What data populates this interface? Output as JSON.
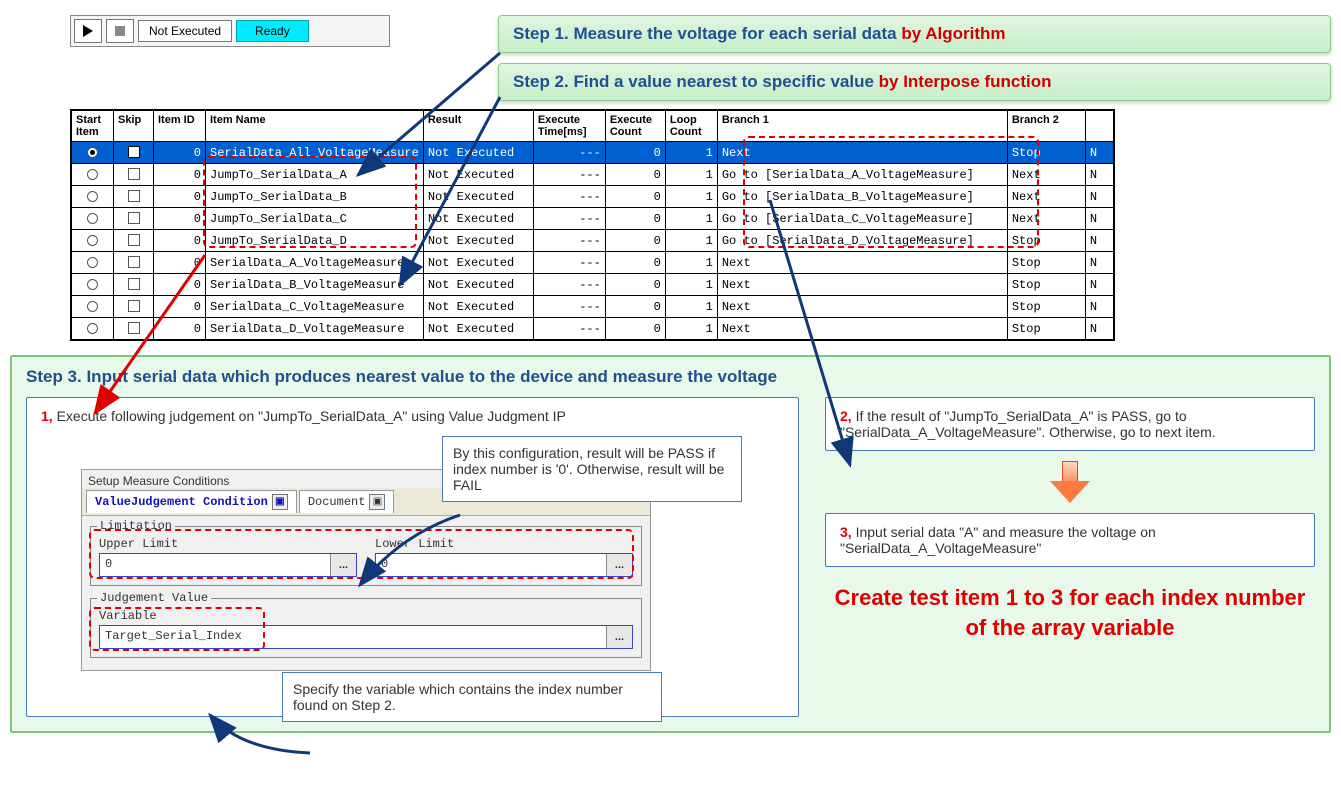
{
  "steps": {
    "s1_a": "Step 1. Measure the voltage for each serial data ",
    "s1_b": "by Algorithm",
    "s2_a": "Step 2. Find a value nearest to specific value ",
    "s2_b": "by Interpose function",
    "s3_title": "Step 3. Input serial data which produces nearest value to the device and measure the voltage"
  },
  "toolbar": {
    "not_executed": "Not Executed",
    "ready": "Ready"
  },
  "grid": {
    "headers": {
      "start": "Start\nItem",
      "skip": "Skip",
      "item_id": "Item ID",
      "item_name": "Item Name",
      "result": "Result",
      "exec_time": "Execute\nTime[ms]",
      "exec_count": "Execute\nCount",
      "loop_count": "Loop\nCount",
      "branch1": "Branch 1",
      "branch2": "Branch 2"
    },
    "rows": [
      {
        "sel": true,
        "start": true,
        "skip": true,
        "id": "0",
        "name": "SerialData_All_VoltageMeasure",
        "result": "Not Executed",
        "time": "---",
        "ecount": "0",
        "lcount": "1",
        "b1": "Next",
        "b2": "Stop",
        "b3": "N"
      },
      {
        "sel": false,
        "start": false,
        "skip": false,
        "id": "0",
        "name": "JumpTo_SerialData_A",
        "result": "Not Executed",
        "time": "---",
        "ecount": "0",
        "lcount": "1",
        "b1": "Go to [SerialData_A_VoltageMeasure]",
        "b2": "Next",
        "b3": "N"
      },
      {
        "sel": false,
        "start": false,
        "skip": false,
        "id": "0",
        "name": "JumpTo_SerialData_B",
        "result": "Not Executed",
        "time": "---",
        "ecount": "0",
        "lcount": "1",
        "b1": "Go to [SerialData_B_VoltageMeasure]",
        "b2": "Next",
        "b3": "N"
      },
      {
        "sel": false,
        "start": false,
        "skip": false,
        "id": "0",
        "name": "JumpTo_SerialData_C",
        "result": "Not Executed",
        "time": "---",
        "ecount": "0",
        "lcount": "1",
        "b1": "Go to [SerialData_C_VoltageMeasure]",
        "b2": "Next",
        "b3": "N"
      },
      {
        "sel": false,
        "start": false,
        "skip": false,
        "id": "0",
        "name": "JumpTo_SerialData_D",
        "result": "Not Executed",
        "time": "---",
        "ecount": "0",
        "lcount": "1",
        "b1": "Go to [SerialData_D_VoltageMeasure]",
        "b2": "Stop",
        "b3": "N"
      },
      {
        "sel": false,
        "start": false,
        "skip": false,
        "id": "0",
        "name": "SerialData_A_VoltageMeasure",
        "result": "Not Executed",
        "time": "---",
        "ecount": "0",
        "lcount": "1",
        "b1": "Next",
        "b2": "Stop",
        "b3": "N"
      },
      {
        "sel": false,
        "start": false,
        "skip": false,
        "id": "0",
        "name": "SerialData_B_VoltageMeasure",
        "result": "Not Executed",
        "time": "---",
        "ecount": "0",
        "lcount": "1",
        "b1": "Next",
        "b2": "Stop",
        "b3": "N"
      },
      {
        "sel": false,
        "start": false,
        "skip": false,
        "id": "0",
        "name": "SerialData_C_VoltageMeasure",
        "result": "Not Executed",
        "time": "---",
        "ecount": "0",
        "lcount": "1",
        "b1": "Next",
        "b2": "Stop",
        "b3": "N"
      },
      {
        "sel": false,
        "start": false,
        "skip": false,
        "id": "0",
        "name": "SerialData_D_VoltageMeasure",
        "result": "Not Executed",
        "time": "---",
        "ecount": "0",
        "lcount": "1",
        "b1": "Next",
        "b2": "Stop",
        "b3": "N"
      }
    ]
  },
  "notes": {
    "n1_num": "1,",
    "n1_txt": " Execute following judgement on \"JumpTo_SerialData_A\" using Value Judgment IP",
    "config": "By this configuration, result will be PASS if index number is '0'. Otherwise, result will be FAIL",
    "spec": "Specify the variable which contains the index number found on Step 2.",
    "n2_num": "2,",
    "n2_txt": " If the result of \"JumpTo_SerialData_A\" is PASS, go to \"SerialData_A_VoltageMeasure\". Otherwise, go to next item.",
    "n3_num": "3,",
    "n3_txt": " Input serial data \"A\" and measure the voltage on \"SerialData_A_VoltageMeasure\"",
    "big": "Create test item 1 to 3 for each index number of the array variable"
  },
  "setup": {
    "title": "Setup Measure Conditions",
    "tab1": "ValueJudgement Condition",
    "tab2": "Document",
    "limitation": "Limitation",
    "upper": "Upper Limit",
    "upper_val": "0",
    "lower": "Lower Limit",
    "lower_val": "0",
    "jv": "Judgement Value",
    "variable": "Variable",
    "var_val": "Target_Serial_Index",
    "dots": "..."
  }
}
